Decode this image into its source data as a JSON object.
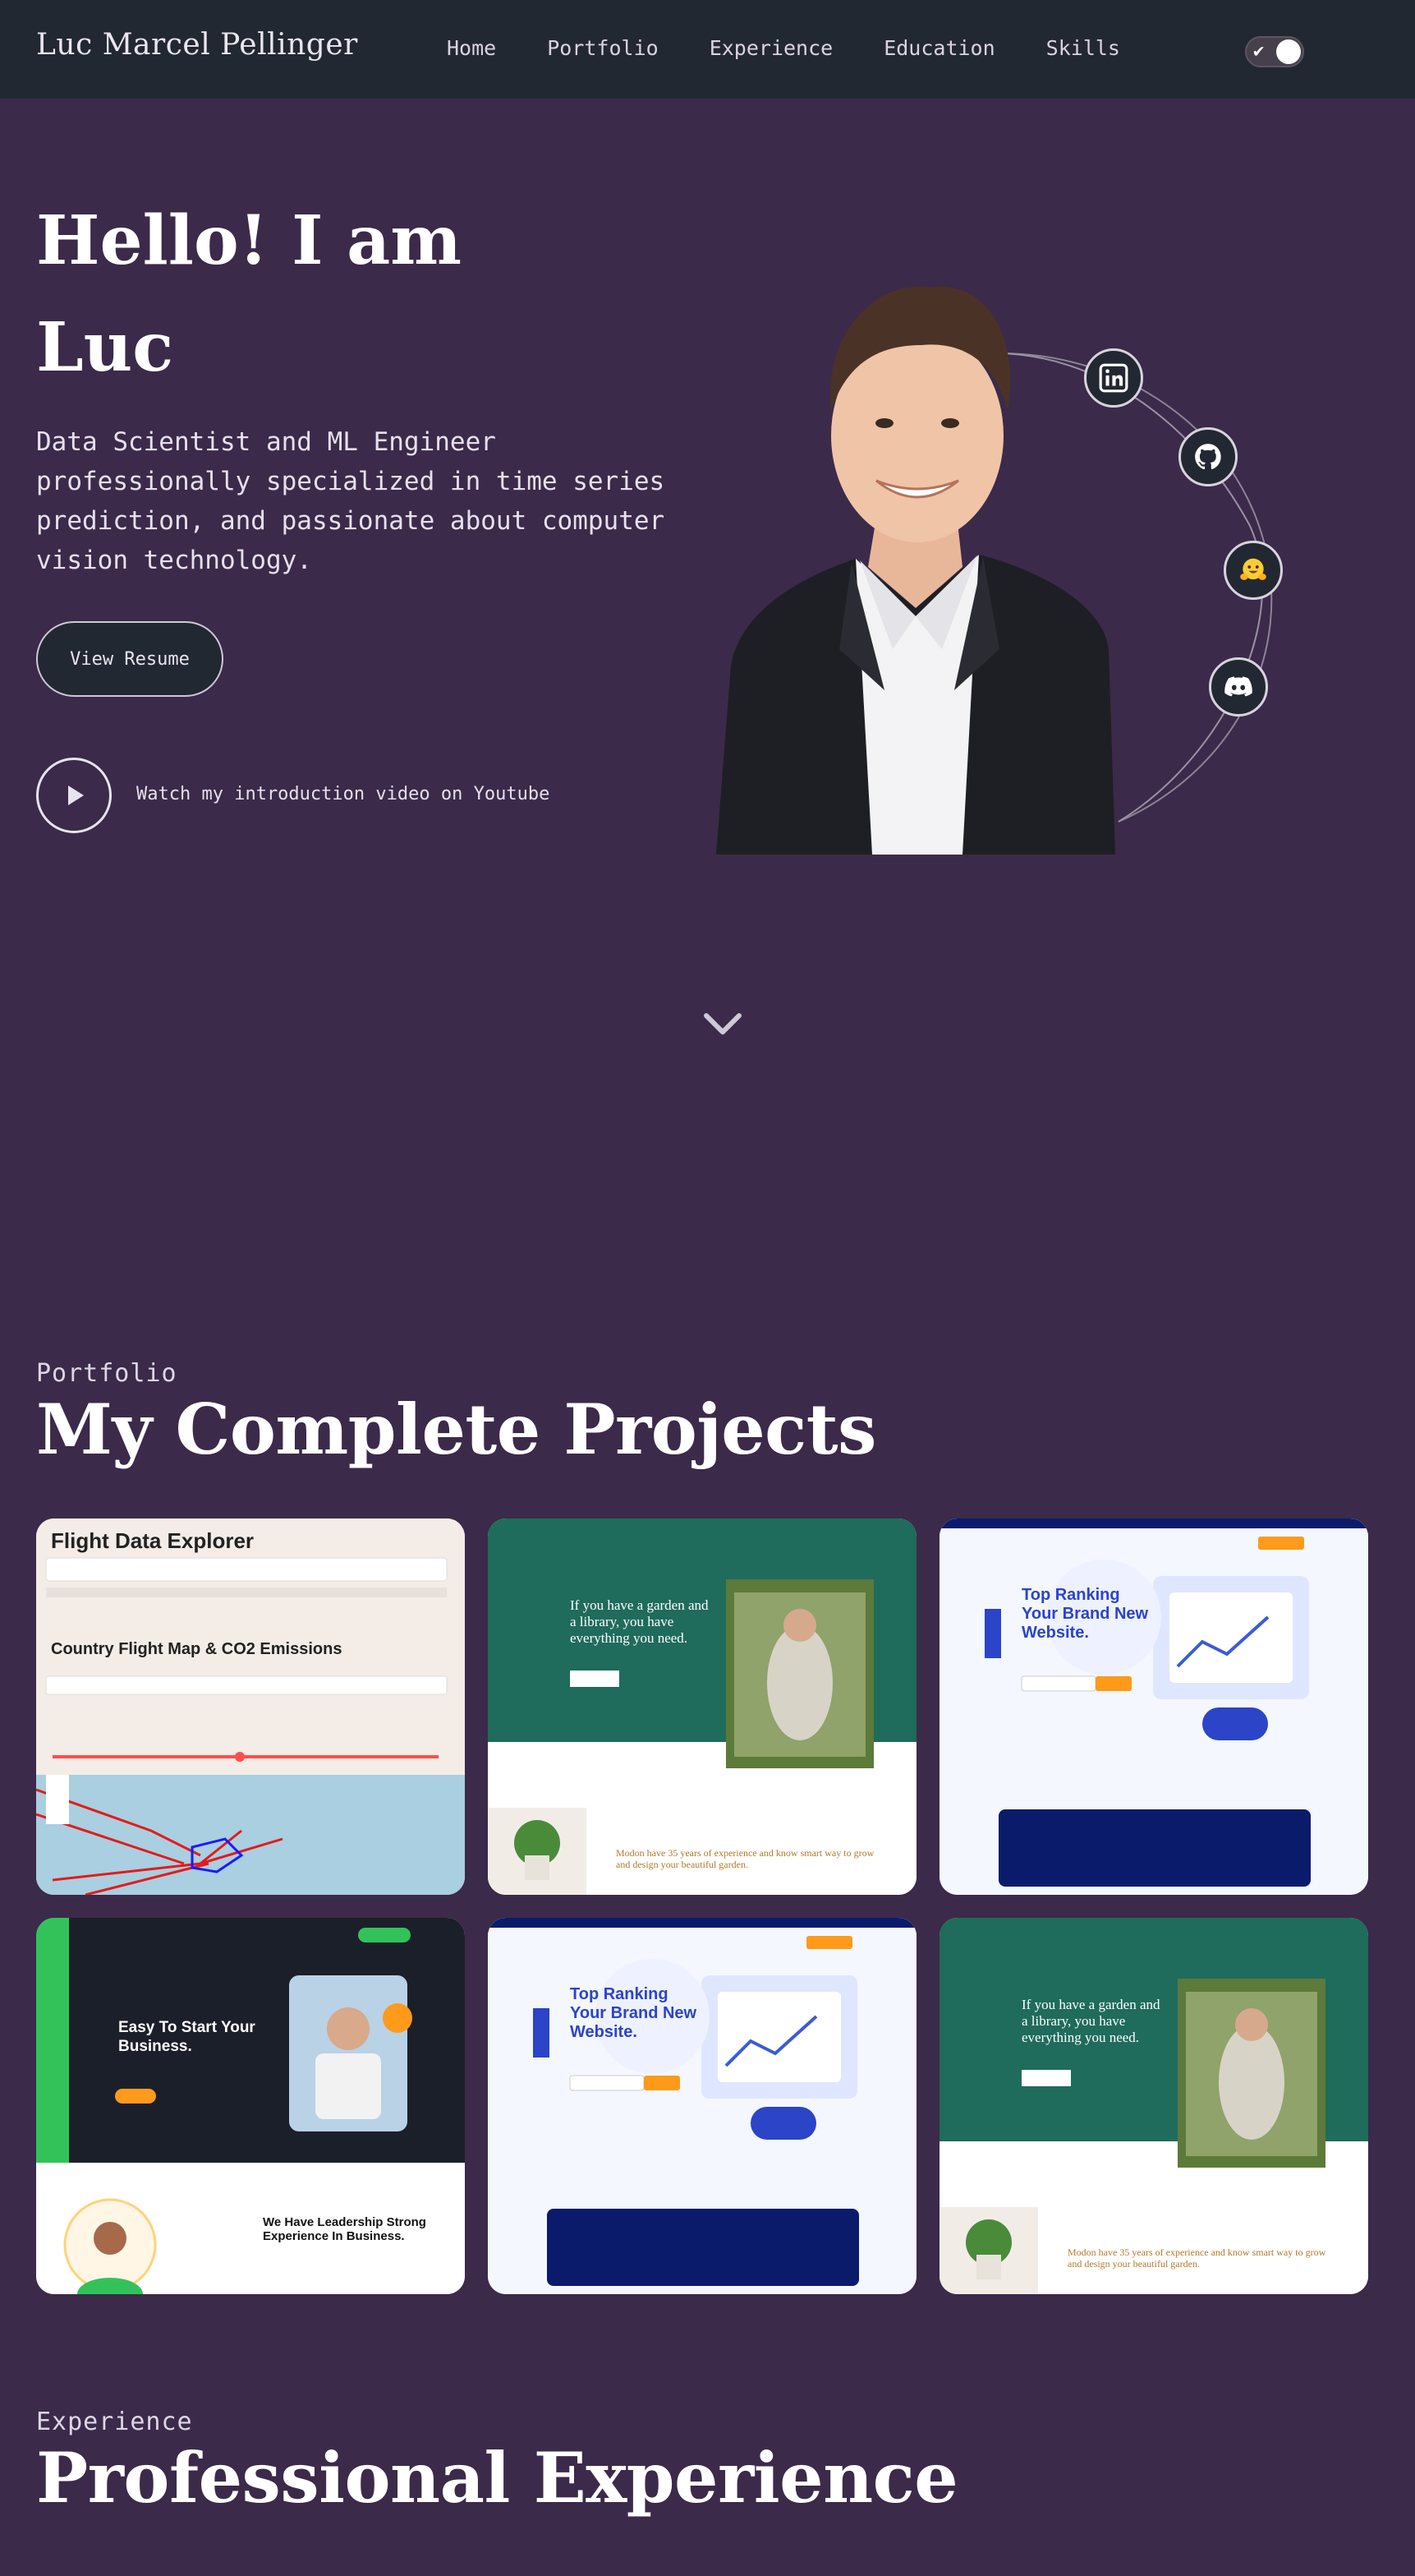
{
  "nav": {
    "brand": "Luc Marcel Pellinger",
    "links": [
      "Home",
      "Portfolio",
      "Experience",
      "Education",
      "Skills"
    ],
    "toggle_check": "✔"
  },
  "hero": {
    "title_line1": "Hello! I am",
    "title_line2": "Luc",
    "description": "Data Scientist and ML Engineer professionally specialized in time series prediction, and passionate about computer vision technology.",
    "resume_button": "View Resume",
    "video_text": "Watch my introduction video on Youtube"
  },
  "portfolio": {
    "label": "Portfolio",
    "title": "My Complete Projects",
    "cards": [
      {
        "title": "Flight Data Explorer",
        "subtitle": "Country Flight Map & CO2 Emissions"
      },
      {
        "heading": "If you have a garden and a library, you have everything you need.",
        "footer": "Modon have 35 years of experience and know smart way to grow and design your beautiful garden."
      },
      {
        "heading": "Top Ranking Your Brand New Website."
      },
      {
        "heading": "Easy To Start Your Business.",
        "footer": "We Have Leadership Strong Experience In Business."
      },
      {
        "heading": "Top Ranking Your Brand New Website."
      },
      {
        "heading": "If you have a garden and a library, you have everything you need.",
        "footer": "Modon have 35 years of experience and know smart way to grow and design your beautiful garden."
      }
    ]
  },
  "experience": {
    "label": "Experience",
    "title": "Professional Experience"
  },
  "colors": {
    "background": "#3b2a4a",
    "navbar": "#222831",
    "text": "#ffffff"
  },
  "icons": [
    "linkedin-icon",
    "github-icon",
    "huggingface-icon",
    "discord-icon",
    "play-icon",
    "chevron-down-icon"
  ]
}
